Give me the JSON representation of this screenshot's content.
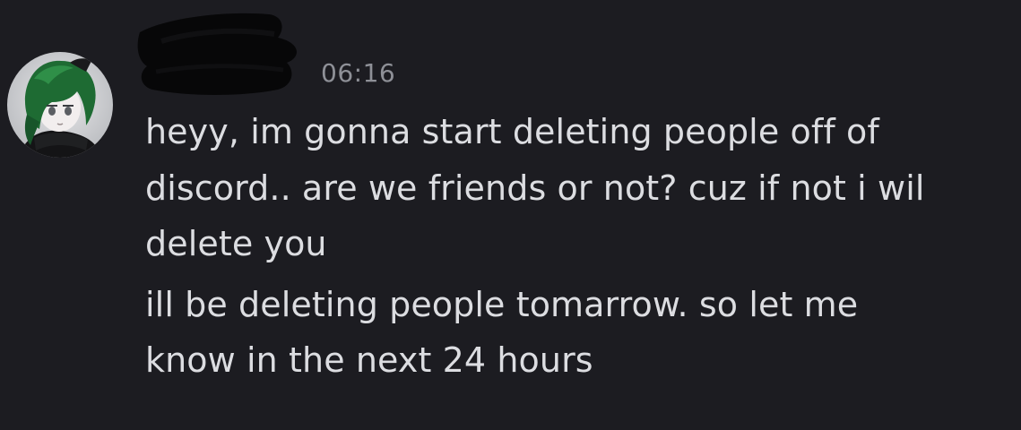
{
  "message_group": {
    "timestamp": "06:16",
    "avatar_icon": "anime-avatar-icon",
    "username_redacted": true,
    "messages": [
      {
        "text": "heyy, im gonna start deleting people off of\ndiscord.. are we friends or not? cuz if not i wil\ndelete you"
      },
      {
        "text": "ill be deleting people tomarrow. so let me\nknow in the next 24 hours"
      }
    ]
  },
  "colors": {
    "background": "#1c1c21",
    "message_text": "#dcdde1",
    "timestamp_text": "#8e9097",
    "redaction": "#070708"
  }
}
